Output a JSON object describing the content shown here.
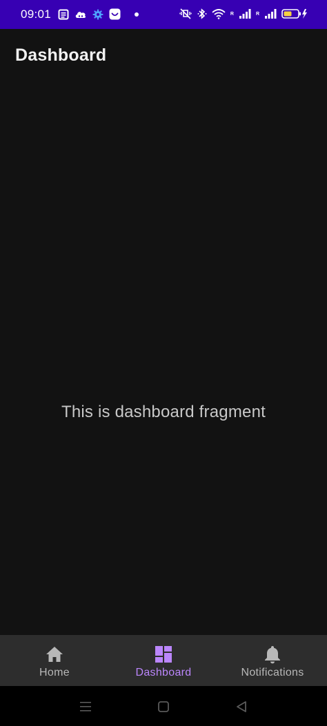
{
  "status_bar": {
    "time": "09:01",
    "network_label_1": "R",
    "network_label_2": "R",
    "icons": [
      "notes-icon",
      "cloud-game-icon",
      "settings-gear-icon",
      "smile-app-icon",
      "notification-dot",
      "mute-vibrate-icon",
      "bluetooth-icon",
      "wifi-icon",
      "signal-icon",
      "signal-icon",
      "battery-charging-icon"
    ],
    "background_color": "#3700b3"
  },
  "app_bar": {
    "title": "Dashboard"
  },
  "content": {
    "message": "This is dashboard fragment"
  },
  "bottom_nav": {
    "items": [
      {
        "label": "Home",
        "icon": "home-icon",
        "active": false
      },
      {
        "label": "Dashboard",
        "icon": "dashboard-icon",
        "active": true
      },
      {
        "label": "Notifications",
        "icon": "bell-icon",
        "active": false
      }
    ],
    "active_color": "#bb86fc",
    "inactive_color": "#b8b8b8",
    "background_color": "#2d2d2d"
  },
  "system_nav": {
    "buttons": [
      "menu-icon",
      "home-square-icon",
      "back-triangle-icon"
    ]
  },
  "colors": {
    "background": "#121212",
    "text_primary": "#f1f1f1",
    "text_secondary": "#c8c8c8"
  }
}
